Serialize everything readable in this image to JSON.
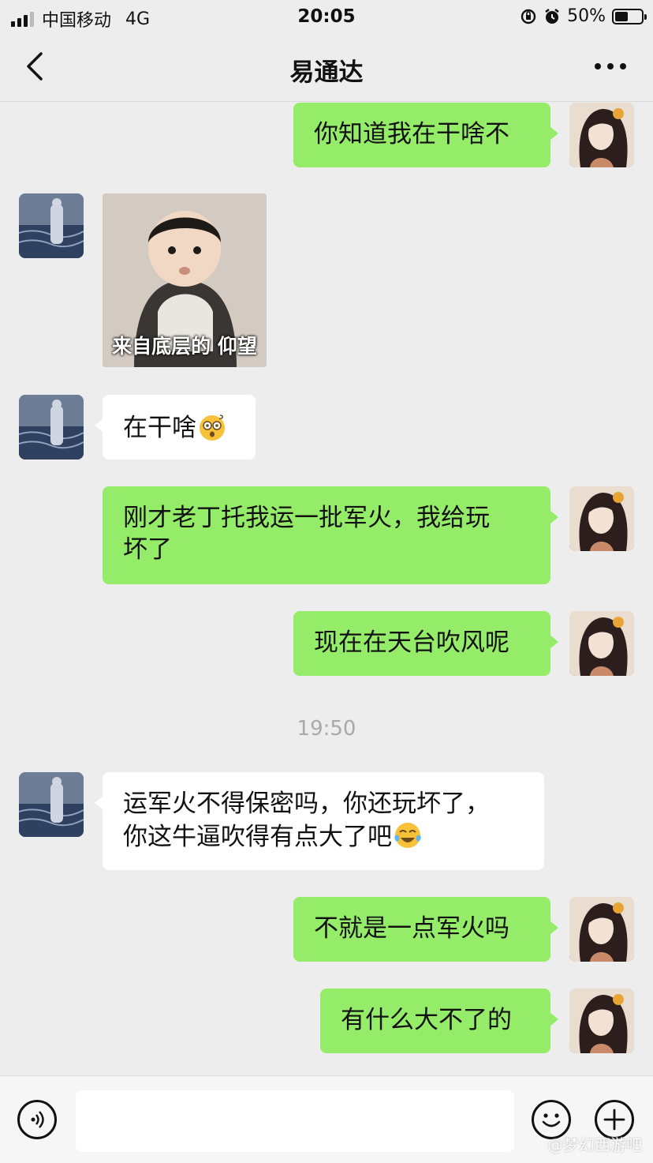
{
  "status_bar": {
    "carrier": "中国移动",
    "network": "4G",
    "time": "20:05",
    "battery": "50%",
    "battery_level": 0.5
  },
  "header": {
    "title": "易通达"
  },
  "messages": [
    {
      "from": "me",
      "text": "你知道我在干啥不"
    },
    {
      "from": "other",
      "type": "sticker",
      "caption": "来自底层的 仰望"
    },
    {
      "from": "other",
      "text": "在干啥",
      "emoji": "dizzy-face"
    },
    {
      "from": "me",
      "text_line1": "刚才老丁托我运一批军火，我给玩",
      "text_line2": "坏了"
    },
    {
      "from": "me",
      "text": "现在在天台吹风呢"
    },
    {
      "from": "other",
      "text_line1": "运军火不得保密吗，你还玩坏了，",
      "text_line2": "你这牛逼吹得有点大了吧",
      "emoji": "tears-of-joy"
    },
    {
      "from": "me",
      "text": "不就是一点军火吗"
    },
    {
      "from": "me",
      "text": "有什么大不了的"
    }
  ],
  "timestamp": "19:50",
  "watermark": "@梦幻西游吧",
  "colors": {
    "my_bubble": "#95ec69",
    "other_bubble": "#ffffff",
    "background": "#ededed"
  }
}
